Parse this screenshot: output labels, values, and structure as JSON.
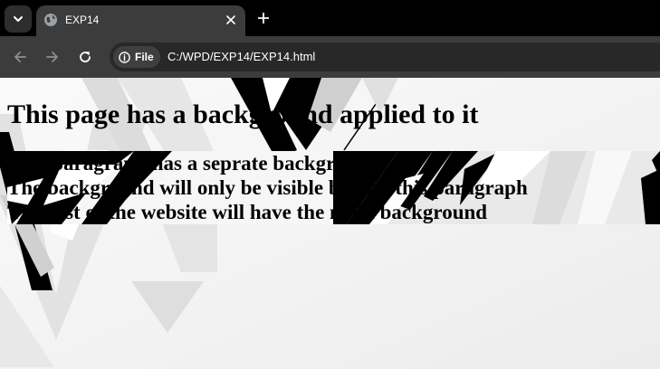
{
  "browser": {
    "tab_title": "EXP14",
    "address_chip_label": "File",
    "url": "C:/WPD/EXP14/EXP14.html"
  },
  "page": {
    "heading": "This page has a background applied to it",
    "paragraph_lines": [
      "This paragraph has a seprate background",
      "The background will only be visible behind this paragraph",
      "The rest of the website will have the main background"
    ]
  },
  "colors": {
    "tabstrip": "#000000",
    "tab_active": "#3c3c3c",
    "toolbar": "#3c3c3c",
    "omnibox": "#282828",
    "page_bg": "#f3f3f3",
    "text": "#000000"
  },
  "icons": [
    "chevron-down-icon",
    "globe-icon",
    "close-icon",
    "plus-icon",
    "back-arrow-icon",
    "forward-arrow-icon",
    "reload-icon",
    "info-icon"
  ]
}
